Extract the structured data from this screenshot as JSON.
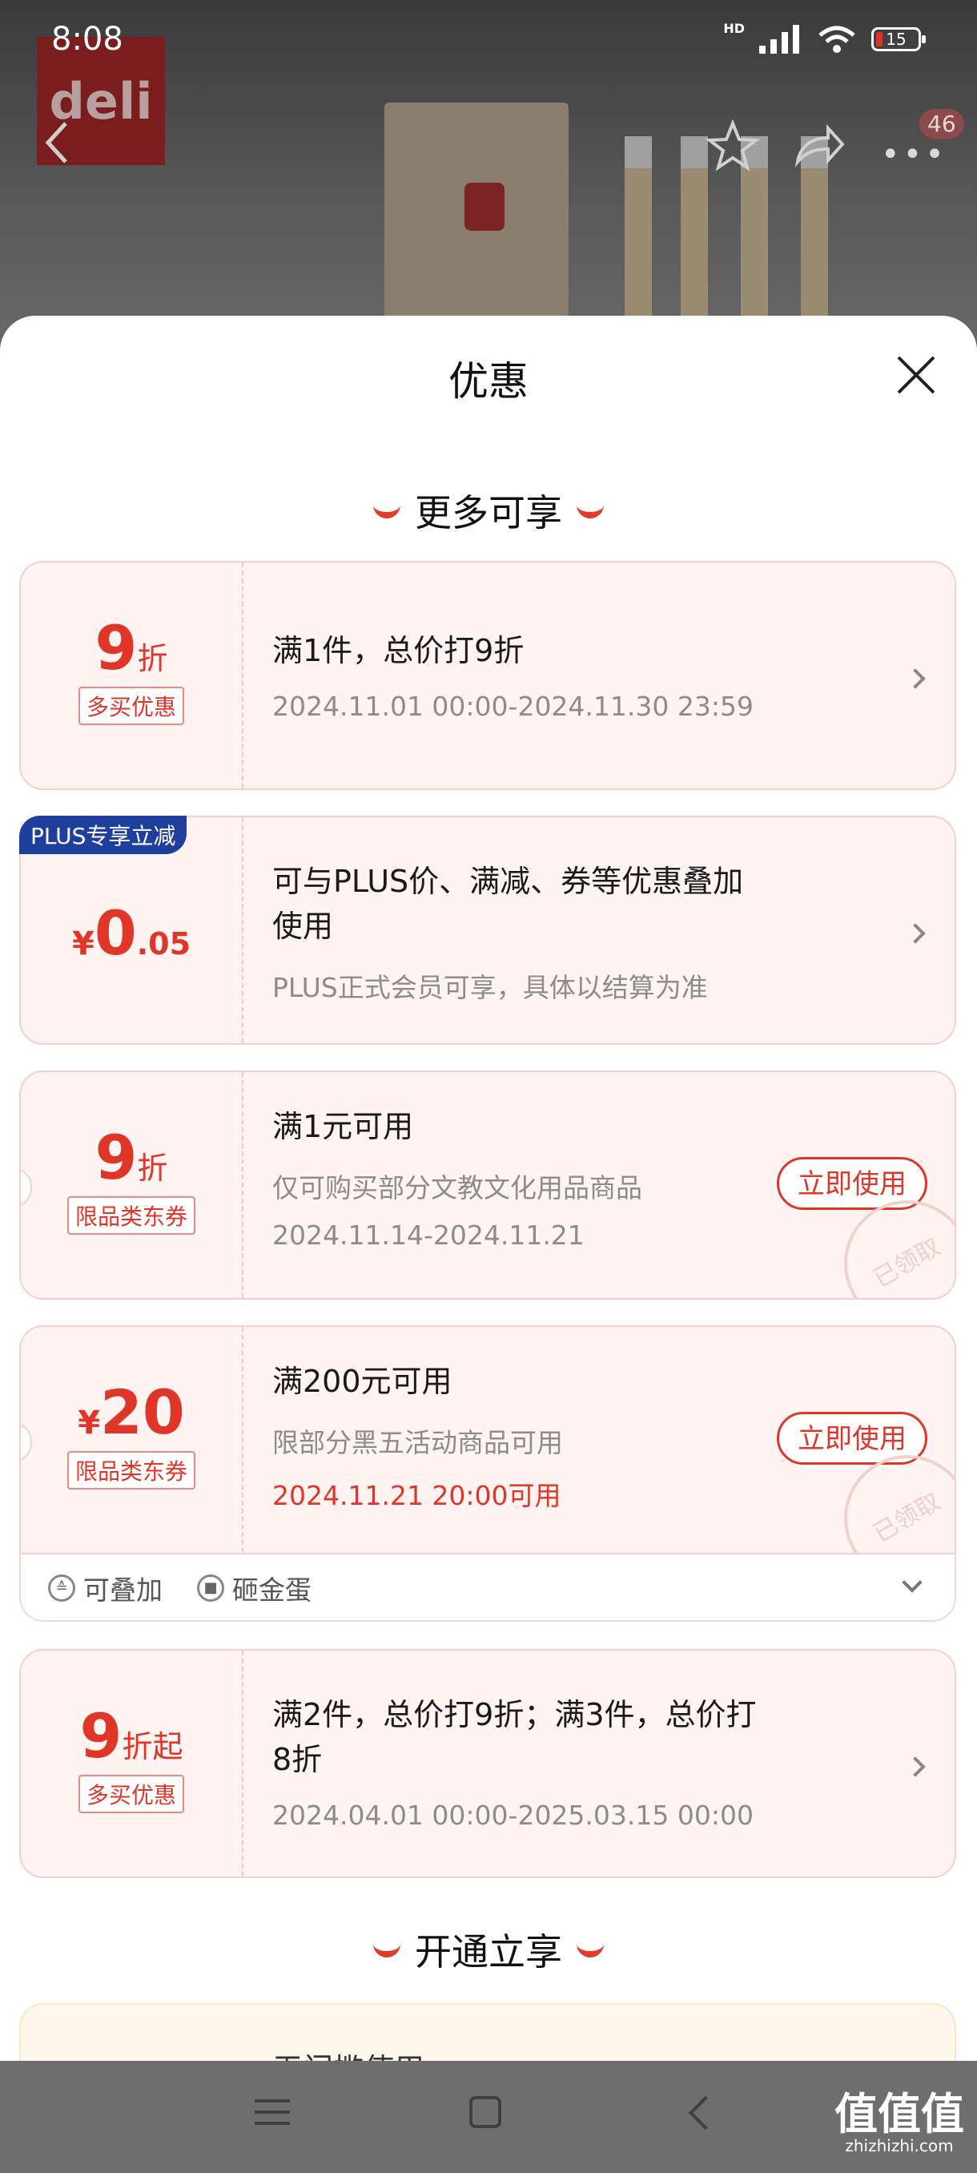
{
  "status_bar": {
    "time": "8:08",
    "hd": "HD",
    "battery": "15"
  },
  "page_header": {
    "brand_logo_text": "deli",
    "cart_badge": "46"
  },
  "sheet": {
    "title": "优惠",
    "section_more": "更多可享",
    "section_open": "开通立享",
    "cards": [
      {
        "big_num": "9",
        "big_unit": "折",
        "tag": "多买优惠",
        "main": "满1件，总价打9折",
        "sub": "2024.11.01 00:00-2024.11.30 23:59"
      },
      {
        "plus_tag": "PLUS专享立减",
        "yen": "¥",
        "big_num": "0",
        "big_dec": ".05",
        "main_line1": "可与PLUS价、满减、券等优惠叠加",
        "main_line2": "使用",
        "sub": "PLUS正式会员可享，具体以结算为准"
      },
      {
        "big_num": "9",
        "big_unit": "折",
        "tag": "限品类东券",
        "main": "满1元可用",
        "sub1": "仅可购买部分文教文化用品商品",
        "sub2": "2024.11.14-2024.11.21",
        "button": "立即使用",
        "stamp": "已领取"
      },
      {
        "yen": "¥",
        "big_num": "20",
        "tag": "限品类东券",
        "main": "满200元可用",
        "sub1": "限部分黑五活动商品可用",
        "sub2": "2024.11.21 20:00可用",
        "button": "立即使用",
        "stamp": "已领取",
        "footer_stack": "可叠加",
        "footer_egg": "砸金蛋"
      },
      {
        "big_num": "9",
        "big_unit": "折起",
        "tag": "多买优惠",
        "main_line1": "满2件，总价打9折；满3件，总价打",
        "main_line2": "8折",
        "sub": "2024.04.01 00:00-2025.03.15 00:00"
      }
    ],
    "peek_text": "无门槛使用"
  },
  "watermark": {
    "main": "值值值",
    "small": "zhizhizhi.com"
  }
}
